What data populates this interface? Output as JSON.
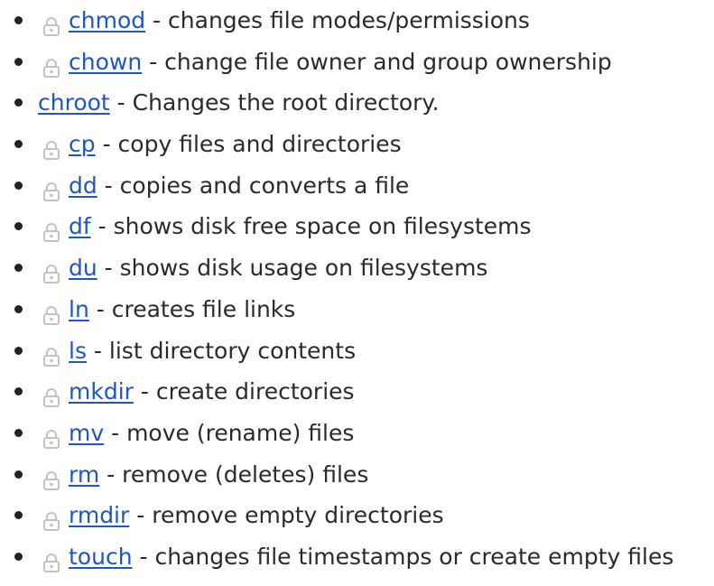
{
  "colors": {
    "link": "#1f57bf",
    "text": "#2a2a2a",
    "icon": "#c2c2c2"
  },
  "separator": " - ",
  "commands": [
    {
      "name": "chmod",
      "description": "changes file modes/permissions",
      "icon": "lock-icon"
    },
    {
      "name": "chown",
      "description": "change file owner and group ownership",
      "icon": "lock-icon"
    },
    {
      "name": "chroot",
      "description": "Changes the root directory.",
      "icon": ""
    },
    {
      "name": "cp",
      "description": "copy files and directories",
      "icon": "lock-icon"
    },
    {
      "name": "dd",
      "description": "copies and converts a file",
      "icon": "lock-icon"
    },
    {
      "name": "df",
      "description": "shows disk free space on filesystems",
      "icon": "lock-icon"
    },
    {
      "name": "du",
      "description": "shows disk usage on filesystems",
      "icon": "lock-icon"
    },
    {
      "name": "ln",
      "description": "creates file links",
      "icon": "lock-icon"
    },
    {
      "name": "ls",
      "description": "list directory contents",
      "icon": "lock-icon"
    },
    {
      "name": "mkdir",
      "description": "create directories",
      "icon": "lock-icon"
    },
    {
      "name": "mv",
      "description": "move (rename) files",
      "icon": "lock-icon"
    },
    {
      "name": "rm",
      "description": "remove (deletes) files",
      "icon": "lock-icon"
    },
    {
      "name": "rmdir",
      "description": "remove empty directories",
      "icon": "lock-icon"
    },
    {
      "name": "touch",
      "description": "changes file timestamps or create empty files",
      "icon": "lock-icon"
    }
  ]
}
